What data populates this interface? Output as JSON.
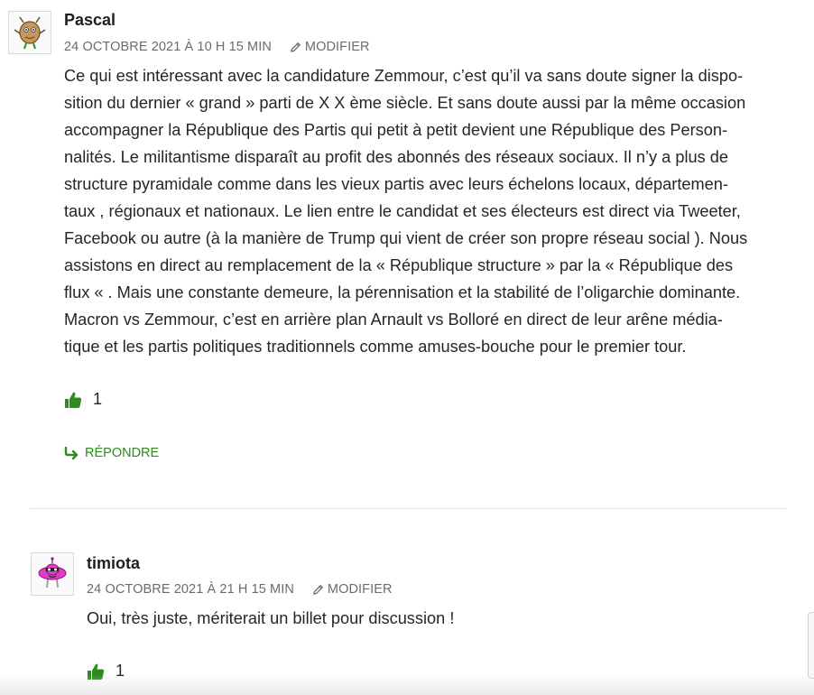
{
  "comments": [
    {
      "author": "Pascal",
      "date": "24 OCTOBRE 2021 À 10 H 15 MIN",
      "edit_label": "MODIFIER",
      "lines": [
        "Ce qui est intéressant avec la candidature Zemmour, c’est qu’il va sans doute signer la dispo-",
        "sition du dernier « grand » parti de X X ème siècle. Et sans doute aussi par la même occasion",
        "accompagner la République des Partis qui petit à petit devient une République des Person-",
        "nalités. Le militantisme disparaît au profit des abonnés des réseaux sociaux. Il n’y a plus de",
        "structure pyramidale comme dans les vieux partis avec leurs échelons locaux, départemen-",
        "taux , régionaux et nationaux. Le lien entre le candidat et ses électeurs est direct via Tweeter,",
        "Facebook ou autre (à la manière de Trump qui vient de créer son propre réseau social ). Nous",
        "assistons en direct au remplacement de la « République structure » par la « République des",
        "flux « . Mais une constante demeure, la pérennisation et la stabilité de l’oligarchie dominante.",
        "Macron vs Zemmour, c’est en arrière plan Arnault vs Bolloré en direct de leur arêne média-",
        "tique et les partis politiques traditionnels comme amuses-bouche pour le premier tour."
      ],
      "likes": "1",
      "reply_label": "RÉPONDRE"
    },
    {
      "author": "timiota",
      "date": "24 OCTOBRE 2021 À 21 H 15 MIN",
      "edit_label": "MODIFIER",
      "lines": [
        "Oui, très juste, mériterait un billet pour discussion !"
      ],
      "likes": "1"
    }
  ],
  "colors": {
    "accent_green": "#2e8b1e",
    "meta_gray": "#6b6b6b",
    "avatar1": "#c49a5c",
    "avatar2": "#e23bc6"
  }
}
